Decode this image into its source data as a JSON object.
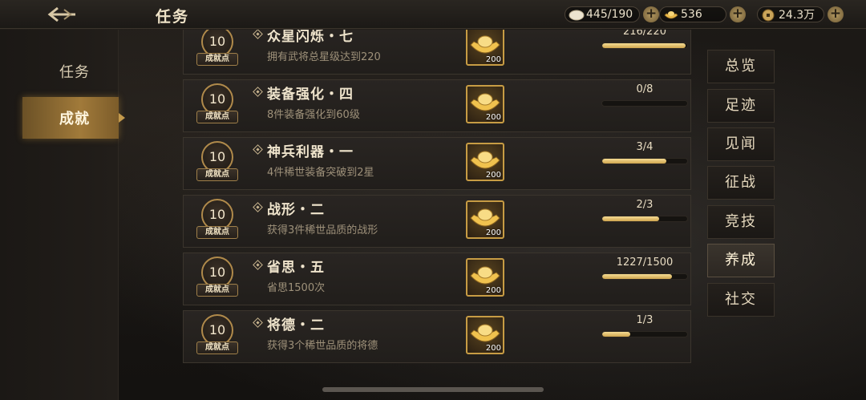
{
  "header": {
    "title": "任务"
  },
  "currencies": [
    {
      "icon": "jade-icon",
      "value": "445/190"
    },
    {
      "icon": "gold-ingot-icon",
      "value": "536"
    },
    {
      "icon": "copper-coin-icon",
      "value": "24.3万"
    }
  ],
  "left_nav": [
    {
      "label": "任务",
      "active": false
    },
    {
      "label": "成就",
      "active": true
    }
  ],
  "categories": [
    {
      "label": "总览",
      "active": false
    },
    {
      "label": "足迹",
      "active": false
    },
    {
      "label": "见闻",
      "active": false
    },
    {
      "label": "征战",
      "active": false
    },
    {
      "label": "竞技",
      "active": false
    },
    {
      "label": "养成",
      "active": true
    },
    {
      "label": "社交",
      "active": false
    }
  ],
  "achievements": [
    {
      "points": "10",
      "points_label": "成就点",
      "title": "众星闪烁・七",
      "desc": "拥有武将总星级达到220",
      "reward_qty": "200",
      "progress_text": "216/220",
      "progress": 0.98
    },
    {
      "points": "10",
      "points_label": "成就点",
      "title": "装备强化・四",
      "desc": "8件装备强化到60级",
      "reward_qty": "200",
      "progress_text": "0/8",
      "progress": 0.0
    },
    {
      "points": "10",
      "points_label": "成就点",
      "title": "神兵利器・一",
      "desc": "4件稀世装备突破到2星",
      "reward_qty": "200",
      "progress_text": "3/4",
      "progress": 0.75
    },
    {
      "points": "10",
      "points_label": "成就点",
      "title": "战形・二",
      "desc": "获得3件稀世品质的战形",
      "reward_qty": "200",
      "progress_text": "2/3",
      "progress": 0.67
    },
    {
      "points": "10",
      "points_label": "成就点",
      "title": "省思・五",
      "desc": "省思1500次",
      "reward_qty": "200",
      "progress_text": "1227/1500",
      "progress": 0.82
    },
    {
      "points": "10",
      "points_label": "成就点",
      "title": "将德・二",
      "desc": "获得3个稀世品质的将德",
      "reward_qty": "200",
      "progress_text": "1/3",
      "progress": 0.33
    }
  ],
  "colors": {
    "accent": "#c79c44",
    "progress": "#e6c06a",
    "panel": "#262220"
  }
}
